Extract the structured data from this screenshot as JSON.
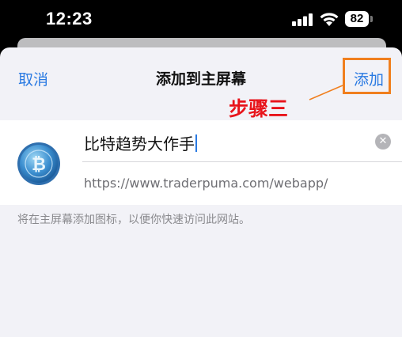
{
  "status": {
    "time": "12:23",
    "battery": "82",
    "icons": [
      "signal-icon",
      "wifi-icon",
      "battery-icon"
    ]
  },
  "nav": {
    "cancel_label": "取消",
    "title": "添加到主屏幕",
    "add_label": "添加"
  },
  "annotation": {
    "step_label": "步骤三",
    "highlight_color": "#f07f1e",
    "step_color": "#e8141b"
  },
  "form": {
    "app_name": "比特趋势大作手",
    "url": "https://www.traderpuma.com/webapp/",
    "app_icon": "bitcoin-coin-icon"
  },
  "hint_text": "将在主屏幕添加图标，以便你快速访问此网站。",
  "colors": {
    "accent": "#2a7ae2",
    "sheet_background": "#f2f2f7"
  }
}
